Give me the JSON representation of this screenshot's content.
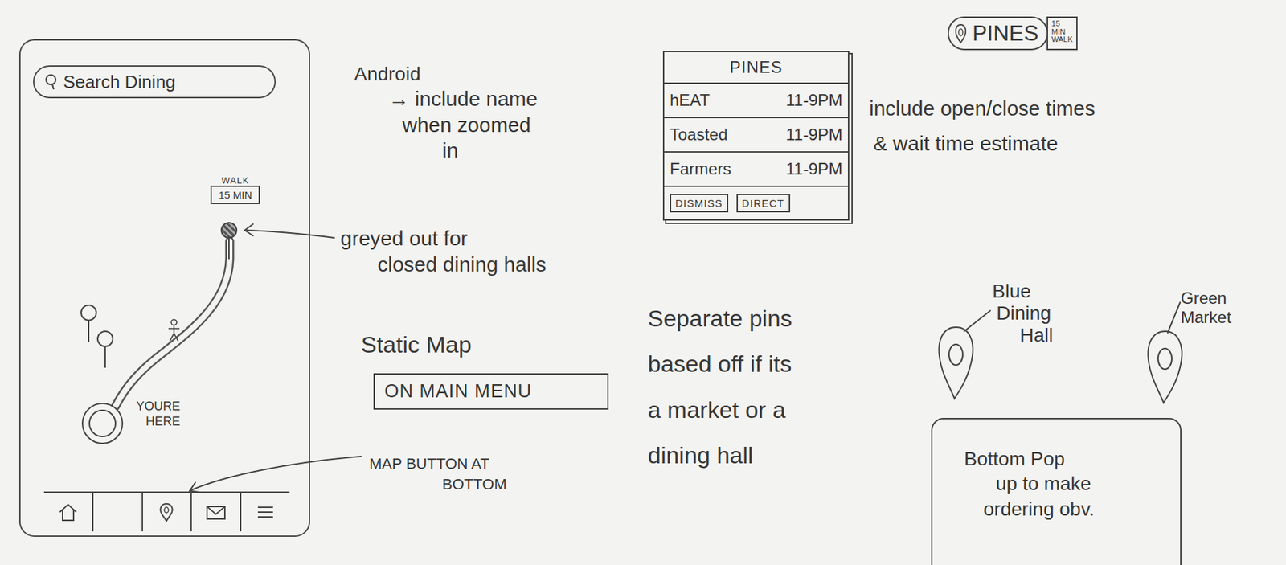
{
  "phone": {
    "search": {
      "placeholder": "Search Dining"
    },
    "walk_badge": {
      "label": "WALK",
      "time": "15 MIN"
    },
    "pins": [
      {
        "closed": true
      },
      {
        "closed": false
      },
      {
        "closed": false
      }
    ],
    "you_are_here": [
      "YOURE",
      "HERE"
    ]
  },
  "notes": {
    "android": {
      "title": "Android",
      "lines": [
        "→ include name",
        "when zoomed",
        "in"
      ]
    },
    "greyed": {
      "lines": [
        "greyed out for",
        "closed dining halls"
      ]
    },
    "static_map": {
      "title": "Static Map",
      "box": "ON MAIN MENU"
    },
    "map_button": {
      "lines": [
        "MAP BUTTON AT",
        "BOTTOM"
      ]
    },
    "times": {
      "lines": [
        "include open/close times",
        "& wait time estimate"
      ]
    },
    "separate": {
      "lines": [
        "Separate pins",
        "based off if its",
        "a market or a",
        "dining hall"
      ]
    },
    "popup": {
      "lines": [
        "Bottom Pop",
        "up to make",
        "ordering obv."
      ]
    }
  },
  "pin_label": {
    "name": "PINES",
    "walk": [
      "15",
      "MIN",
      "WALK"
    ]
  },
  "card": {
    "title": "PINES",
    "rows": [
      {
        "name": "hEAT",
        "hours": "11-9PM"
      },
      {
        "name": "Toasted",
        "hours": "11-9PM"
      },
      {
        "name": "Farmers",
        "hours": "11-9PM"
      }
    ],
    "buttons": [
      "DISMISS",
      "DIRECT"
    ]
  },
  "pin_types": [
    {
      "label": [
        "Blue",
        "Dining",
        "Hall"
      ]
    },
    {
      "label": [
        "Green",
        "Market"
      ]
    }
  ]
}
